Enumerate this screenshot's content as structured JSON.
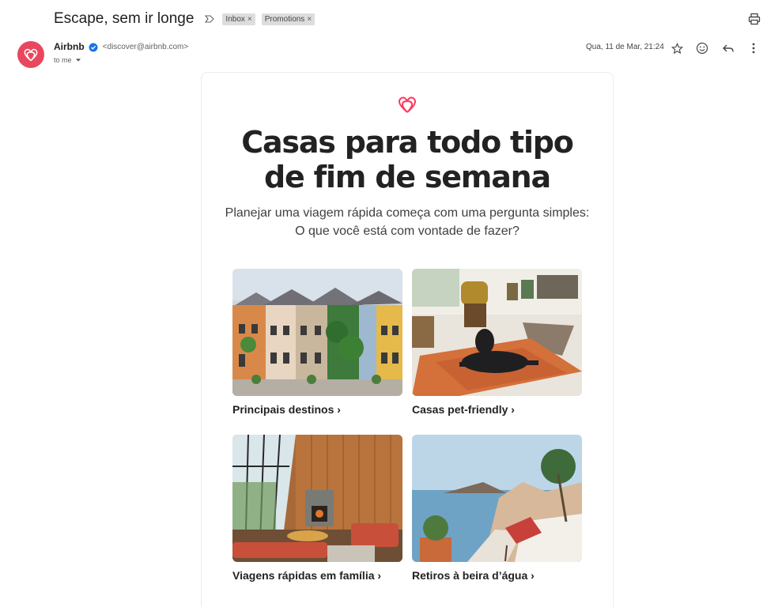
{
  "email": {
    "subject": "Escape, sem ir longe",
    "labels": [
      {
        "text": "Inbox",
        "close": "×"
      },
      {
        "text": "Promotions",
        "close": "×"
      }
    ],
    "sender_name": "Airbnb",
    "sender_email": "<discover@airbnb.com>",
    "to": "to me",
    "date": "Qua, 11 de Mar, 21:24"
  },
  "icons": {
    "print": "printer-icon",
    "label": "label-important-icon",
    "star": "star-icon",
    "emoji": "emoji-reaction-icon",
    "reply": "reply-icon",
    "more": "more-vert-icon",
    "verified": "verified-badge-icon",
    "brand": "airbnb-logo-icon"
  },
  "colors": {
    "brand": "#FF385C",
    "avatar": "#E8475D",
    "chip": "#DDDDDD"
  },
  "body": {
    "headline_line1": "Casas para todo tipo",
    "headline_line2": "de fim de semana",
    "intro_line1": "Planejar uma viagem rápida começa com uma pergunta simples:",
    "intro_line2": "O que você está com vontade de fazer?",
    "tiles": [
      {
        "caption": "Principais destinos ›"
      },
      {
        "caption": "Casas pet-friendly ›"
      },
      {
        "caption": "Viagens rápidas em família ›"
      },
      {
        "caption": "Retiros à beira d’água ›"
      }
    ]
  }
}
